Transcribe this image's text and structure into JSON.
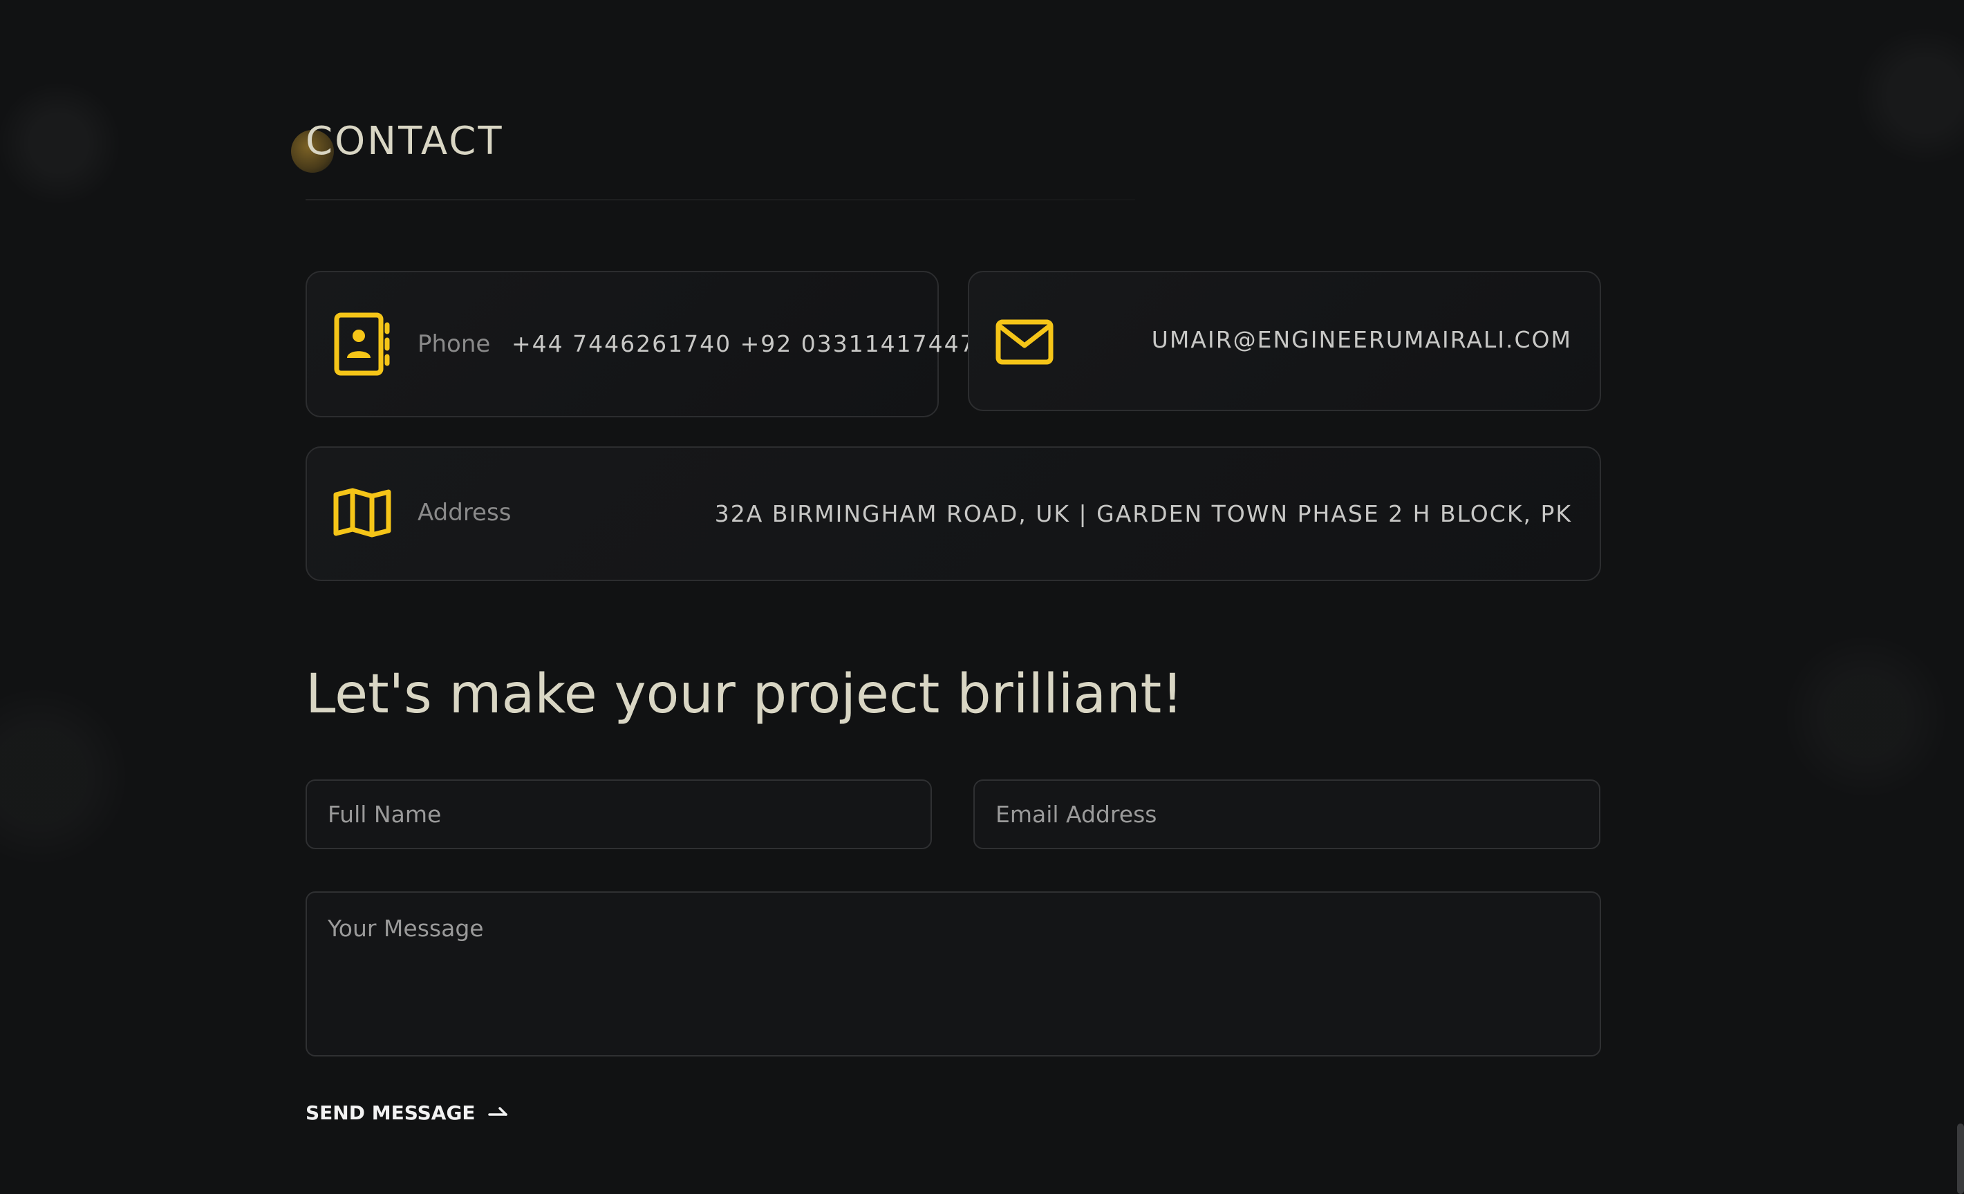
{
  "section": {
    "title": "CONTACT"
  },
  "contact": {
    "phone_label": "Phone",
    "phone_value": "+44 7446261740 +92 03311417447",
    "email_value": "UMAIR@ENGINEERUMAIRALI.COM",
    "address_label": "Address",
    "address_value": "32A BIRMINGHAM ROAD, UK | GARDEN TOWN PHASE 2 H BLOCK, PK",
    "icons": {
      "phone": "contact-book-icon",
      "email": "envelope-icon",
      "address": "map-icon"
    },
    "accent_color": "#F5C518"
  },
  "cta": {
    "heading": "Let's make your project brilliant!"
  },
  "form": {
    "full_name_placeholder": "Full Name",
    "email_placeholder": "Email Address",
    "message_placeholder": "Your Message",
    "send_label": "SEND MESSAGE"
  }
}
